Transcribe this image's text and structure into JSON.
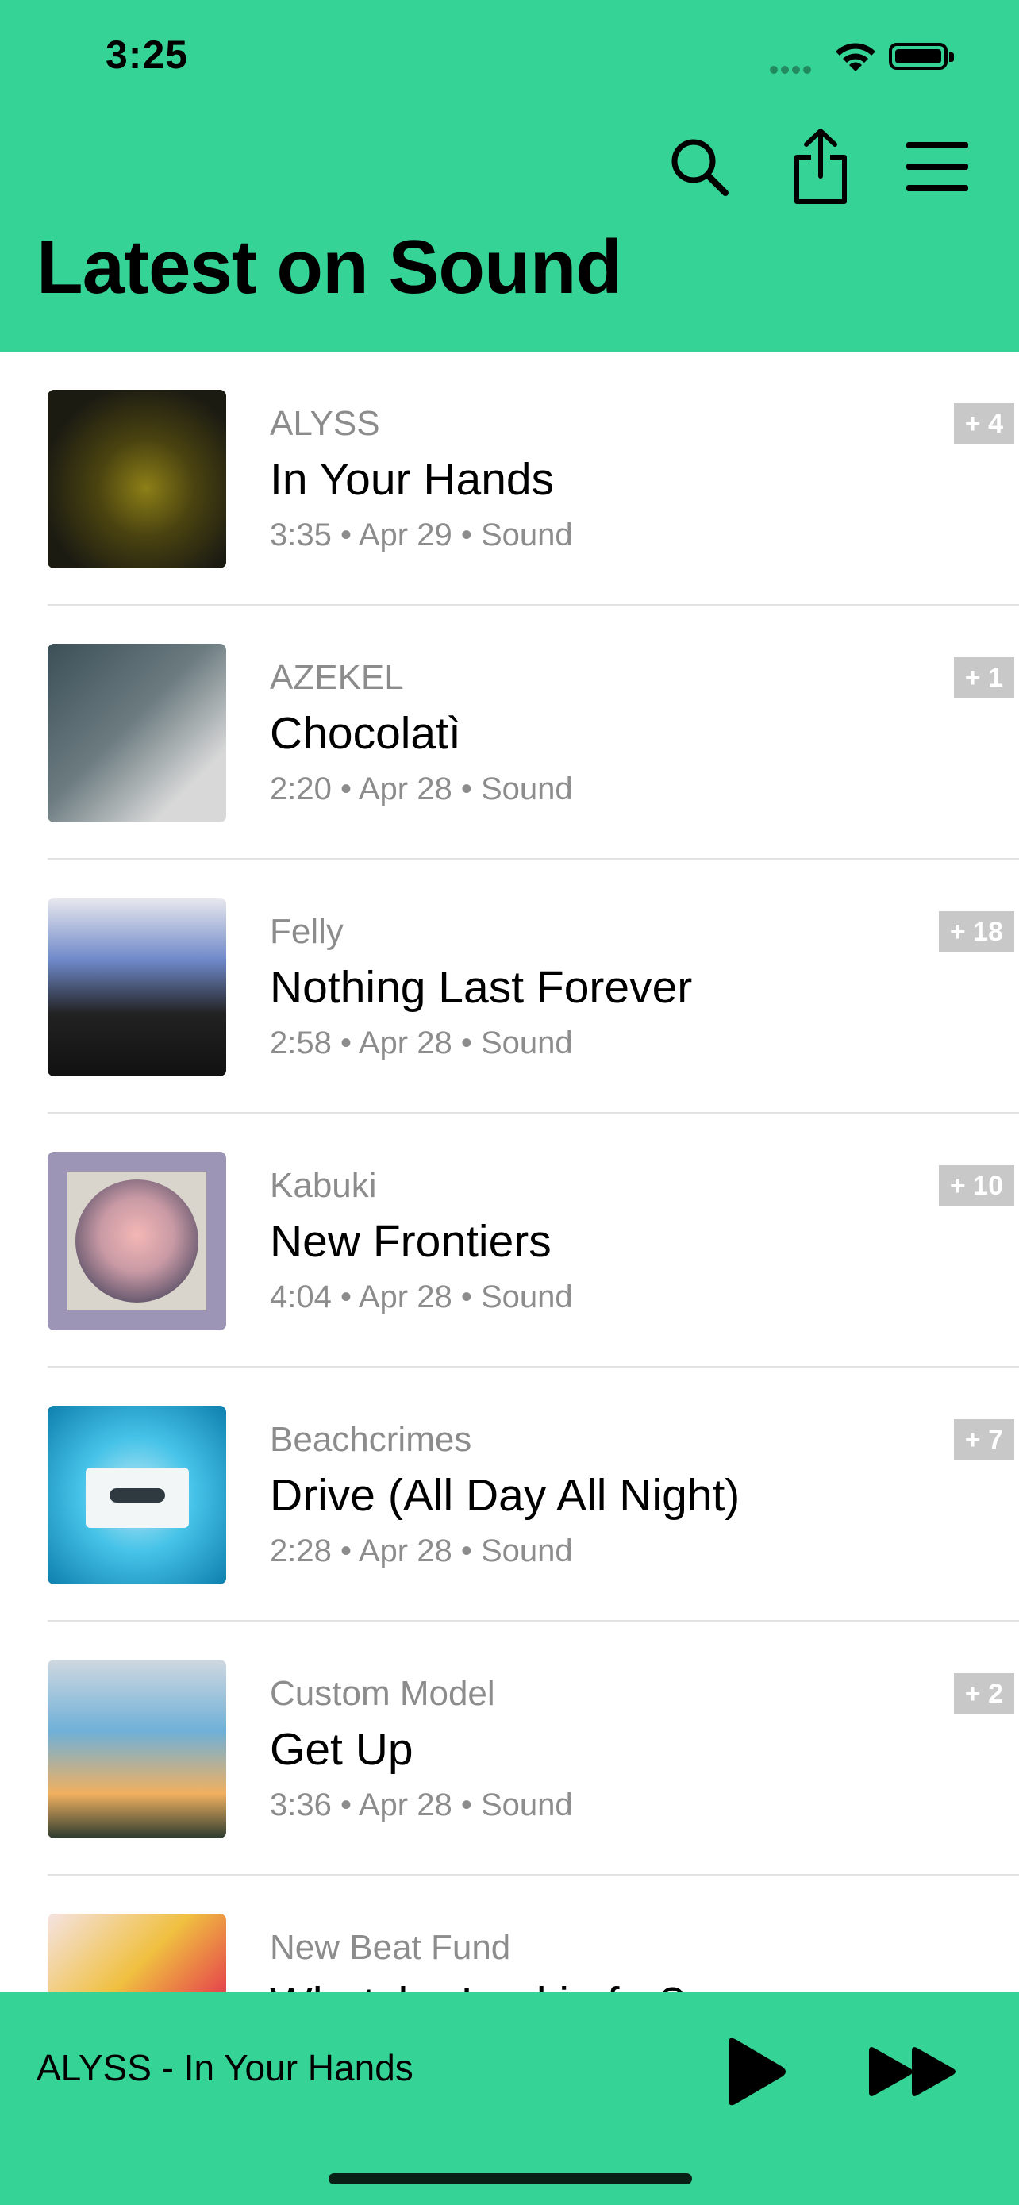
{
  "status_bar": {
    "time": "3:25"
  },
  "header": {
    "title": "Latest on Sound",
    "icons": [
      "search-icon",
      "share-icon",
      "menu-icon"
    ]
  },
  "tracks": [
    {
      "artist": "ALYSS",
      "title": "In Your Hands",
      "meta": "3:35 • Apr 29 • Sound",
      "badge": "+ 4",
      "art_colors": [
        "#1b1b12",
        "#8d7f17"
      ]
    },
    {
      "artist": "AZEKEL",
      "title": "Chocolatì",
      "meta": "2:20 • Apr 28 • Sound",
      "badge": "+ 1",
      "art_colors": [
        "#3c4f57",
        "#d8d8d8"
      ]
    },
    {
      "artist": "Felly",
      "title": "Nothing Last Forever",
      "meta": "2:58 • Apr 28 • Sound",
      "badge": "+ 18",
      "art_colors": [
        "#6e88c9",
        "#111111"
      ]
    },
    {
      "artist": "Kabuki",
      "title": "New Frontiers",
      "meta": "4:04 • Apr 28 • Sound",
      "badge": "+ 10",
      "art_colors": [
        "#9c95b5",
        "#c99aa5"
      ]
    },
    {
      "artist": "Beachcrimes",
      "title": "Drive (All Day All Night)",
      "meta": "2:28 • Apr 28 • Sound",
      "badge": "+ 7",
      "art_colors": [
        "#1ea7d6",
        "#bfe9f5"
      ]
    },
    {
      "artist": "Custom Model",
      "title": "Get Up",
      "meta": "3:36 • Apr 28 • Sound",
      "badge": "+ 2",
      "art_colors": [
        "#6fb0d8",
        "#f1b060"
      ]
    },
    {
      "artist": "New Beat Fund",
      "title": "Whatcha Lookin for?",
      "meta": "",
      "badge": "",
      "art_colors": [
        "#f4e3e3",
        "#e64b4b"
      ]
    }
  ],
  "player": {
    "now_playing": "ALYSS - In Your Hands",
    "icons": [
      "play-icon",
      "fast-forward-icon"
    ]
  }
}
